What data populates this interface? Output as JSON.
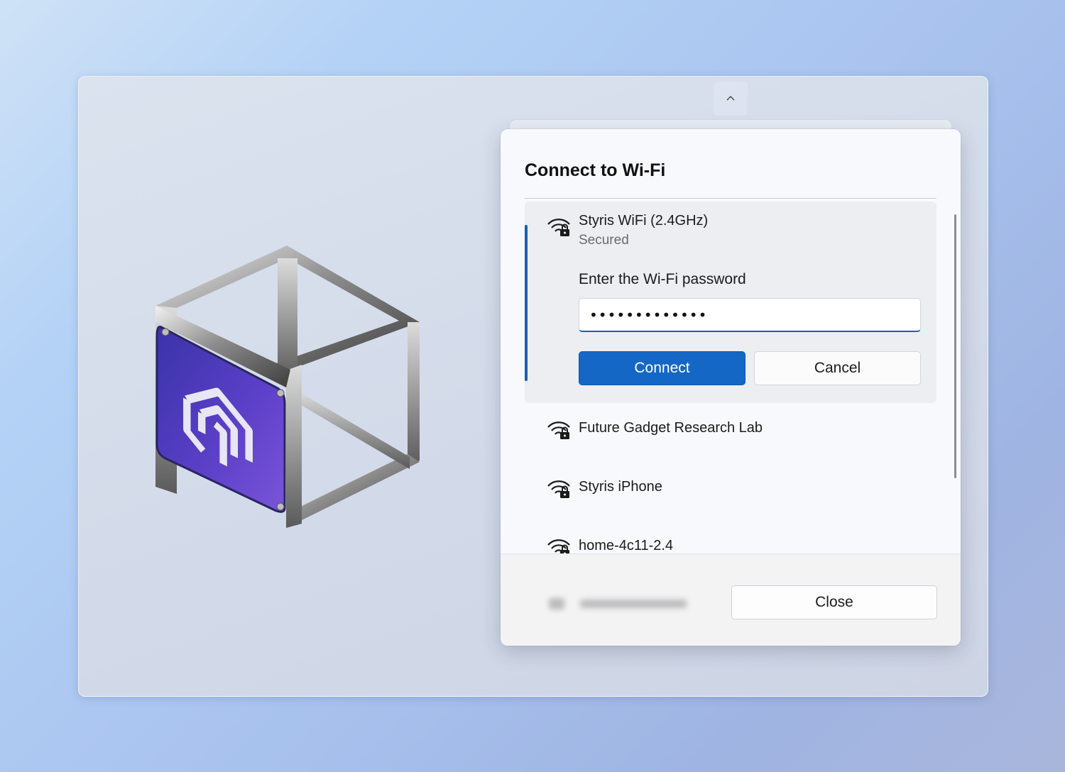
{
  "dialog": {
    "title": "Connect to Wi-Fi"
  },
  "networks": [
    {
      "name": "Styris WiFi (2.4GHz)",
      "status": "Secured",
      "icon": "wifi-secured-icon",
      "password_label": "Enter the Wi-Fi password",
      "password_value": "•••••••••••••",
      "connect_label": "Connect",
      "cancel_label": "Cancel"
    },
    {
      "name": "Future Gadget Research Lab",
      "icon": "wifi-secured-icon"
    },
    {
      "name": "Styris iPhone",
      "icon": "wifi-secured-icon"
    },
    {
      "name": "home-4c11-2.4",
      "icon": "wifi-secured-icon"
    }
  ],
  "footer": {
    "close_label": "Close"
  },
  "colors": {
    "accent": "#1467c4",
    "dialog_bg": "#f8f9fc",
    "footer_bg": "#f3f3f4"
  }
}
